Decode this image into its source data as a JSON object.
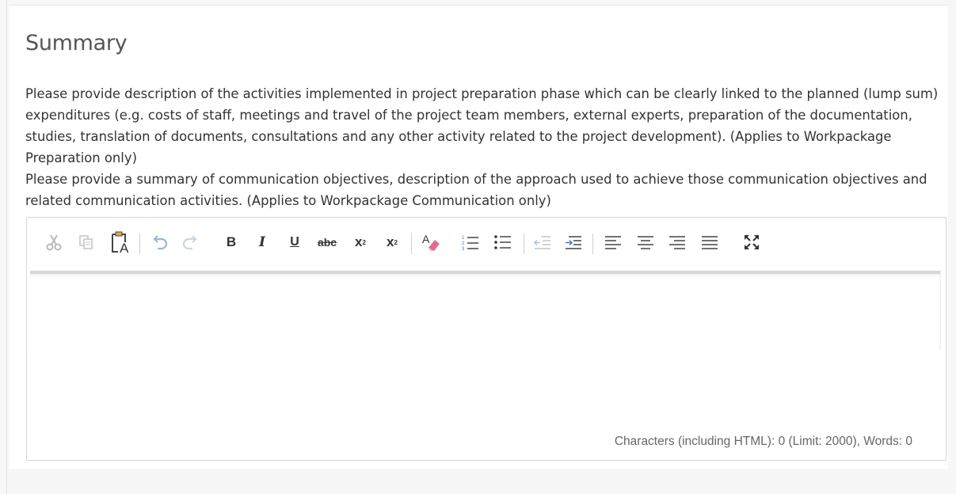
{
  "section": {
    "title": "Summary",
    "description_1": "Please provide description of the activities implemented in project preparation phase which can be clearly linked to the planned (lump sum) expenditures (e.g. costs of staff, meetings and travel of the project team members, external experts, preparation of the documentation, studies, translation of documents, consultations and any other activity related to the project development). (Applies to Workpackage Preparation only)",
    "description_2": "Please provide a summary of communication objectives, description of the approach used to achieve those communication objectives and related communication activities. (Applies to Workpackage Communication only)"
  },
  "editor": {
    "toolbar": {
      "cut_icon": "scissors-icon",
      "copy_icon": "copy-icon",
      "paste_text_icon": "paste-as-text-icon",
      "undo_icon": "undo-icon",
      "redo_icon": "redo-icon",
      "bold_label": "B",
      "italic_label": "I",
      "underline_label": "U",
      "strike_label": "abc",
      "subscript_label": "x",
      "subscript_mark": "2",
      "superscript_label": "x",
      "superscript_mark": "2",
      "remove_format_icon": "eraser-icon",
      "numbered_list_icon": "numbered-list-icon",
      "bullet_list_icon": "bullet-list-icon",
      "outdent_icon": "outdent-icon",
      "indent_icon": "indent-icon",
      "align_left_icon": "align-left-icon",
      "align_center_icon": "align-center-icon",
      "align_right_icon": "align-right-icon",
      "justify_icon": "justify-icon",
      "maximize_icon": "maximize-icon"
    },
    "counter": "Characters (including HTML): 0 (Limit: 2000), Words: 0"
  },
  "colors": {
    "disabled_icon": "#b9b9b9",
    "active_icon": "#333333",
    "undo_icon": "#9ab8d8",
    "indent_accent": "#3a7bd5",
    "eraser_pink": "#e46b8d"
  }
}
